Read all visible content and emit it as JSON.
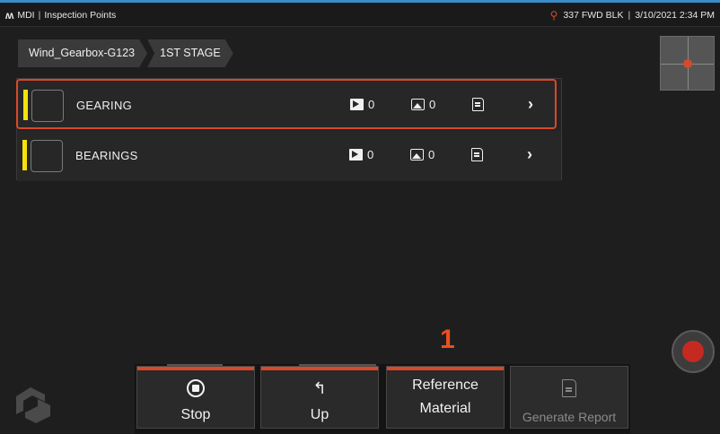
{
  "status": {
    "app_logo": "ʍ",
    "app_name": "MDI",
    "screen_title": "Inspection Points",
    "probe_info": "337 FWD BLK",
    "datetime": "3/10/2021 2:34 PM"
  },
  "breadcrumb": {
    "items": [
      {
        "label": "Wind_Gearbox-G123"
      },
      {
        "label": "1ST STAGE"
      }
    ]
  },
  "inspection_points": {
    "items": [
      {
        "label": "GEARING",
        "video_count": "0",
        "image_count": "0",
        "selected": true,
        "status_color": "#f5e20a"
      },
      {
        "label": "BEARINGS",
        "video_count": "0",
        "image_count": "0",
        "selected": false,
        "status_color": "#f5e20a"
      }
    ]
  },
  "callout": {
    "number": "1"
  },
  "softkeys": {
    "stop": "Stop",
    "up": "Up",
    "reference_line1": "Reference",
    "reference_line2": "Material",
    "generate_report": "Generate Report"
  },
  "colors": {
    "accent": "#d9482a",
    "status_yellow": "#f5e20a",
    "record": "#c42a22",
    "callout": "#e8501e"
  },
  "icons": {
    "video": "video-icon",
    "image": "image-icon",
    "report": "report-icon",
    "chevron": "chevron-right-icon",
    "stop": "stop-icon",
    "up": "up-arrow-icon",
    "generate_report": "document-icon",
    "record": "record-icon",
    "probe": "probe-icon"
  }
}
